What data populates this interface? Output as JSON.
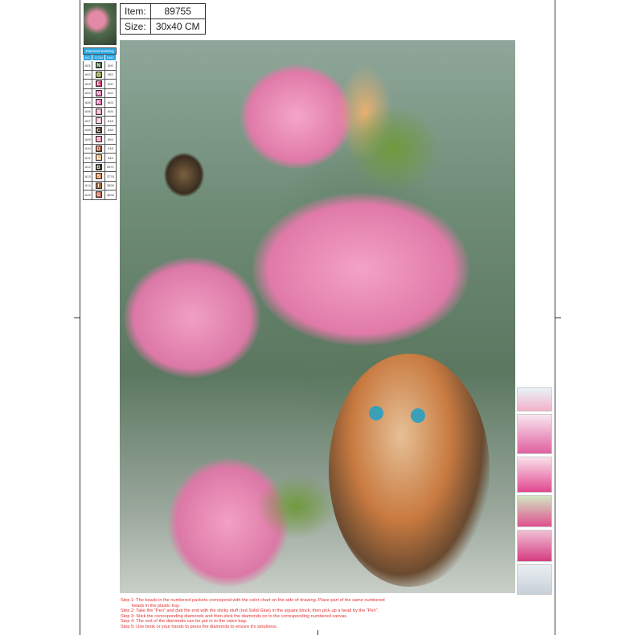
{
  "item": {
    "label": "Item:",
    "value": "89755"
  },
  "size": {
    "label": "Size:",
    "value": "30x40 CM"
  },
  "legend": {
    "title": "Diamond painting",
    "headers": [
      "NO.",
      "ICON",
      "DMC"
    ],
    "rows": [
      {
        "no": "A01",
        "icon": "N",
        "dmc": "500",
        "color": "#3d5a3a"
      },
      {
        "no": "A02",
        "icon": "O",
        "dmc": "581",
        "color": "#7a8a2a"
      },
      {
        "no": "A03",
        "icon": "E",
        "dmc": "600",
        "color": "#c8386a"
      },
      {
        "no": "A04",
        "icon": "M",
        "dmc": "602",
        "color": "#d9569a"
      },
      {
        "no": "A05",
        "icon": "K",
        "dmc": "603",
        "color": "#e870a8"
      },
      {
        "no": "A06",
        "icon": "X",
        "dmc": "605",
        "color": "#eaa0c0"
      },
      {
        "no": "A07",
        "icon": "J",
        "dmc": "818",
        "color": "#f2c6d2"
      },
      {
        "no": "A08",
        "icon": "C",
        "dmc": "838",
        "color": "#4a3a2a"
      },
      {
        "no": "A09",
        "icon": "S",
        "dmc": "894",
        "color": "#ea8aa6"
      },
      {
        "no": "A10",
        "icon": "D",
        "dmc": "918",
        "color": "#9a4a2a"
      },
      {
        "no": "A11",
        "icon": "L",
        "dmc": "945",
        "color": "#e6c096"
      },
      {
        "no": "A12",
        "icon": "B",
        "dmc": "3371",
        "color": "#2e2418"
      },
      {
        "no": "A13",
        "icon": "S",
        "dmc": "3776",
        "color": "#d88046"
      },
      {
        "no": "A14",
        "icon": "I",
        "dmc": "3826",
        "color": "#ac6a30"
      },
      {
        "no": "A15",
        "icon": "G",
        "dmc": "3830",
        "color": "#b85848"
      }
    ]
  },
  "steps": [
    "Step 1: The beads in the numbered packets correspond with the color chart on the side of drawing. Place part of the same numbered",
    "beads in the plastic tray.",
    "Step 2: Take the \"Pen\" and dab the end with the sticky stuff (red Solid Glue) in the square block, then pick up a bead by the \"Pen\".",
    "Step 3: Stick the corresponding diamonds and then stick the diamonds on to the corresponding numbered canvas.",
    "Step 4: The rest of the diamonds can be put in to the valve bag.",
    "Step 5: Use book or your hands to press the diamonds to ensure it's stoutness."
  ]
}
